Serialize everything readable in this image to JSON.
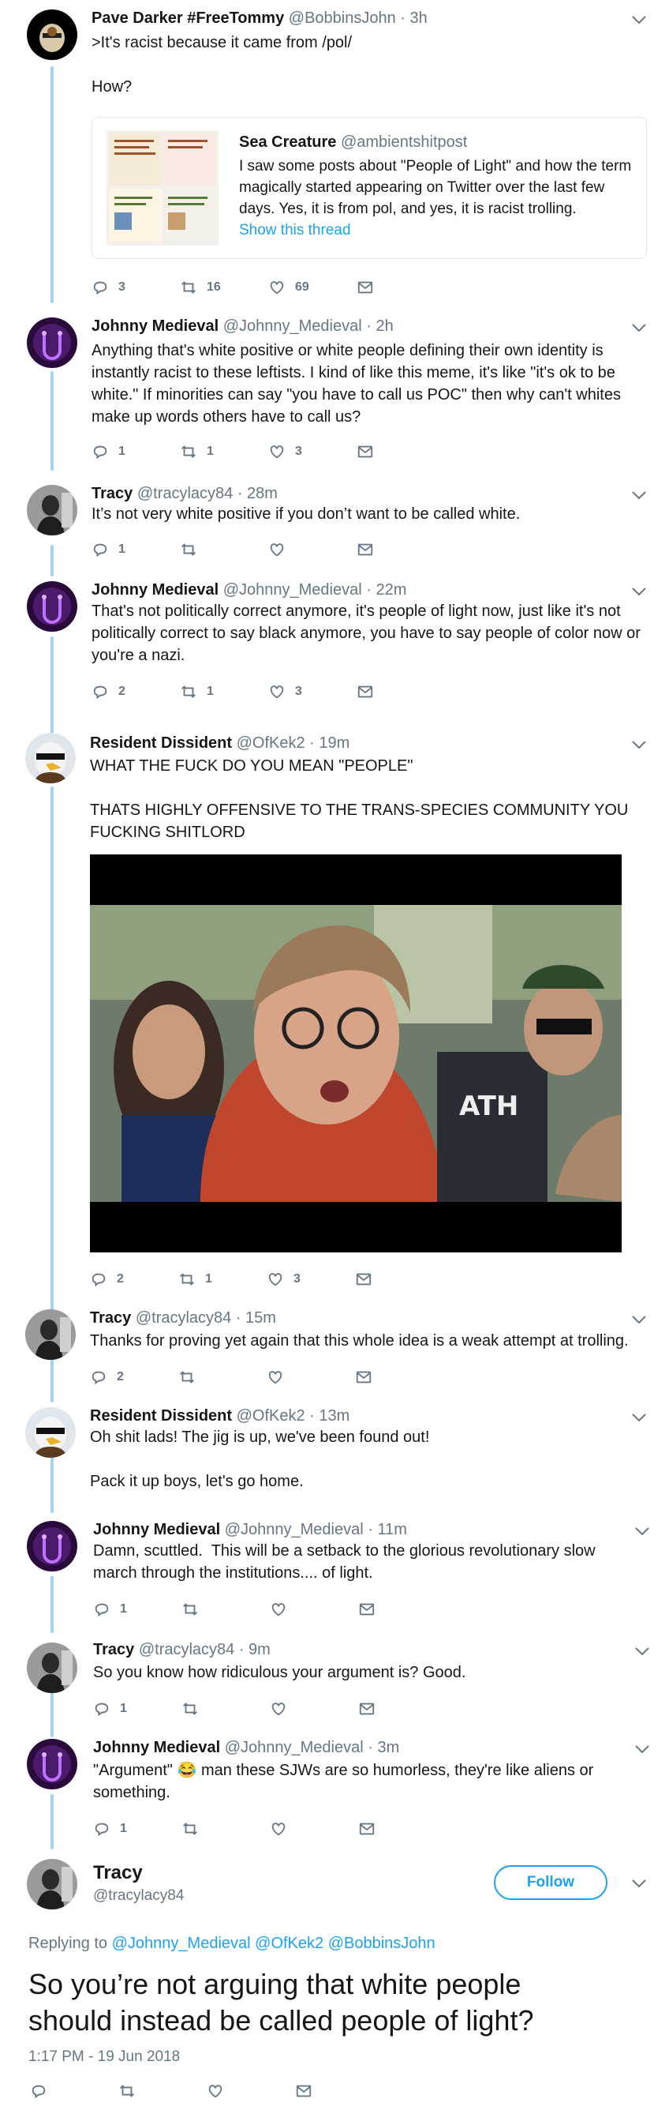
{
  "tweets": [
    {
      "name": "Pave Darker #FreeTommy",
      "handle": "@BobbinsJohn · 3h",
      "text": ">It's racist because it came from /pol/\n\nHow?",
      "replies": "3",
      "retweets": "16",
      "likes": "69"
    },
    {
      "name": "Johnny Medieval",
      "handle": "@Johnny_Medieval · 2h",
      "text": "Anything that's white positive or white people defining their own identity is instantly racist to these leftists. I kind of like this meme, it's like \"it's ok to be white.\" If minorities can say \"you have to call us POC\" then why can't whites make up words others have to call us?",
      "replies": "1",
      "retweets": "1",
      "likes": "3"
    },
    {
      "name": "Tracy",
      "handle": "@tracylacy84 · 28m",
      "text": "It’s not very white positive if you don’t want to be called white.",
      "replies": "1",
      "retweets": "",
      "likes": ""
    },
    {
      "name": "Johnny Medieval",
      "handle": "@Johnny_Medieval · 22m",
      "text": "That's not politically correct anymore, it's people of light now, just like it's not politically correct to say black anymore, you have to say people of color now or you're a nazi.",
      "replies": "2",
      "retweets": "1",
      "likes": "3"
    },
    {
      "name": "Resident Dissident",
      "handle": "@OfKek2 · 19m",
      "text": "WHAT THE FUCK DO YOU MEAN \"PEOPLE\"\n\nTHATS HIGHLY OFFENSIVE TO THE TRANS-SPECIES COMMUNITY YOU FUCKING SHITLORD",
      "replies": "2",
      "retweets": "1",
      "likes": "3"
    },
    {
      "name": "Tracy",
      "handle": "@tracylacy84 · 15m",
      "text": "Thanks for proving yet again that this whole idea is a weak attempt at trolling.",
      "replies": "2",
      "retweets": "",
      "likes": ""
    },
    {
      "name": "Resident Dissident",
      "handle": "@OfKek2 · 13m",
      "text": "Oh shit lads! The jig is up, we've been found out!\n\nPack it up boys, let's go home.",
      "replies": "",
      "retweets": "",
      "likes": ""
    },
    {
      "name": "Johnny Medieval",
      "handle": "@Johnny_Medieval · 11m",
      "text": "Damn, scuttled.  This will be a setback to the glorious revolutionary slow march through the institutions.... of light.",
      "replies": "1",
      "retweets": "",
      "likes": ""
    },
    {
      "name": "Tracy",
      "handle": "@tracylacy84 · 9m",
      "text": "So you know how ridiculous your argument is? Good.",
      "replies": "1",
      "retweets": "",
      "likes": ""
    },
    {
      "name": "Johnny Medieval",
      "handle": "@Johnny_Medieval · 3m",
      "text_before": "\"Argument\"",
      "emoji": "😂",
      "text_after": " man these SJWs are so humorless, they're like aliens or something.",
      "replies": "1",
      "retweets": "",
      "likes": ""
    }
  ],
  "quote": {
    "name": "Sea Creature",
    "handle": "@ambientshitpost",
    "text": "I saw some posts about \"People of Light\" and how the term magically started appearing on Twitter over the last few days. Yes, it is from pol, and yes, it is racist trolling.",
    "show_thread": "Show this thread"
  },
  "main_tweet": {
    "name": "Tracy",
    "handle": "@tracylacy84",
    "follow_label": "Follow",
    "replying_to_label": "Replying to",
    "replying_to": "@Johnny_Medieval @OfKek2 @BobbinsJohn",
    "text": "So you’re not arguing that white people should instead be called people of light?",
    "timestamp": "1:17 PM - 19 Jun 2018"
  },
  "colors": {
    "thread_line": "#9fd5f2",
    "link": "#1da1f2",
    "muted": "#657786"
  }
}
